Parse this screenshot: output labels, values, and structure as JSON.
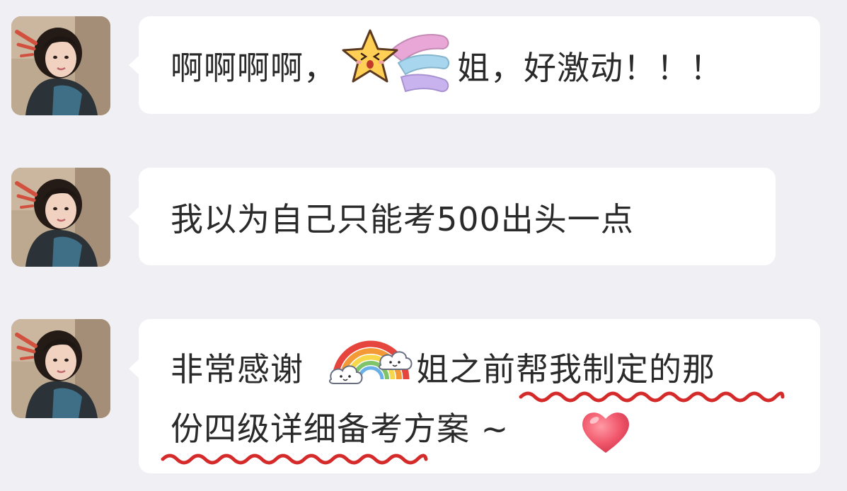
{
  "messages": [
    {
      "avatar_icon": "girl-portrait-avatar",
      "segments": [
        "啊啊啊啊，",
        "姐，好激动！！！"
      ],
      "sticker": "shooting-star-sticker"
    },
    {
      "avatar_icon": "girl-portrait-avatar",
      "text": "我以为自己只能考500出头一点"
    },
    {
      "avatar_icon": "girl-portrait-avatar",
      "line1_segments": [
        "非常感谢",
        "姐之前帮我制定的那"
      ],
      "line2": "份四级详细备考方案 ~",
      "sticker": "rainbow-cloud-sticker",
      "emoji": "pink-heart-emoji",
      "underline_color": "#d42a2a"
    }
  ],
  "colors": {
    "background": "#efeff4",
    "bubble": "#ffffff",
    "text": "#2a2a2a",
    "underline": "#d42a2a"
  }
}
